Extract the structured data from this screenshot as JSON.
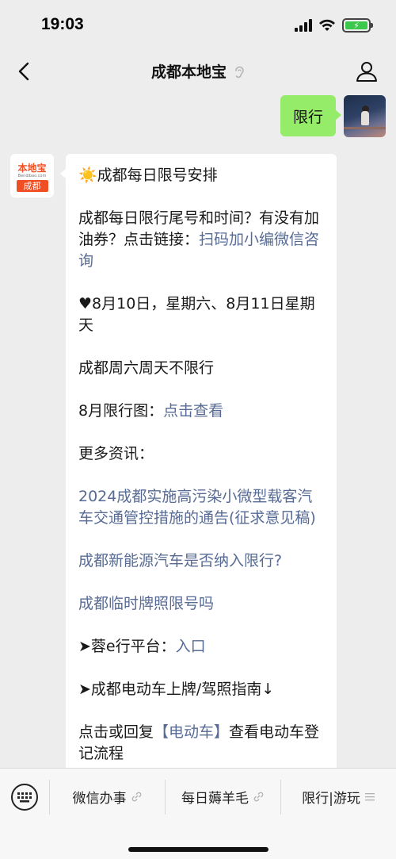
{
  "status_bar": {
    "time": "19:03",
    "battery_icon": "battery-charging-icon",
    "signal_icon": "cellular-signal-icon",
    "wifi_icon": "wifi-icon"
  },
  "nav": {
    "title": "成都本地宝",
    "back_icon": "back-chevron-icon",
    "ear_icon": "ear-icon",
    "profile_icon": "person-icon"
  },
  "chat": {
    "outgoing": {
      "text": "限行"
    },
    "bot_avatar": {
      "logo": "本地宝",
      "site": "Bendibao.com",
      "city": "成都"
    },
    "incoming": {
      "title": "☀️成都每日限号安排",
      "p1_text": "成都每日限行尾号和时间？有没有加油券？点击链接：",
      "p1_link": "扫码加小编微信咨询",
      "p2_text": "♥8月10日，星期六、8月11日星期天",
      "p3_text": "成都周六周天不限行",
      "p4_text": "8月限行图：",
      "p4_link": "点击查看",
      "p5_text": "更多资讯：",
      "link1": "2024成都实施高污染小微型载客汽车交通管控措施的通告(征求意见稿)",
      "link2": "成都新能源汽车是否纳入限行?",
      "link3": "成都临时牌照限号吗",
      "p6_text": "➤蓉e行平台：",
      "p6_link": "入口",
      "p7_text": "➤成都电动车上牌/驾照指南↓",
      "p8_text_a": "点击或回复",
      "p8_link": "【电动车】",
      "p8_text_b": "查看电动车登记流程"
    }
  },
  "bottom_menu": {
    "keyboard_icon": "keyboard-icon",
    "items": [
      {
        "label": "微信办事",
        "suffix_icon": "link-icon"
      },
      {
        "label": "每日薅羊毛",
        "suffix_icon": "link-icon"
      },
      {
        "label": "限行|游玩",
        "suffix_icon": "menu-lines-icon"
      }
    ]
  },
  "colors": {
    "background": "#ededed",
    "outgoing_bubble": "#95ec69",
    "link": "#576b95",
    "brand_orange": "#f04e23"
  }
}
